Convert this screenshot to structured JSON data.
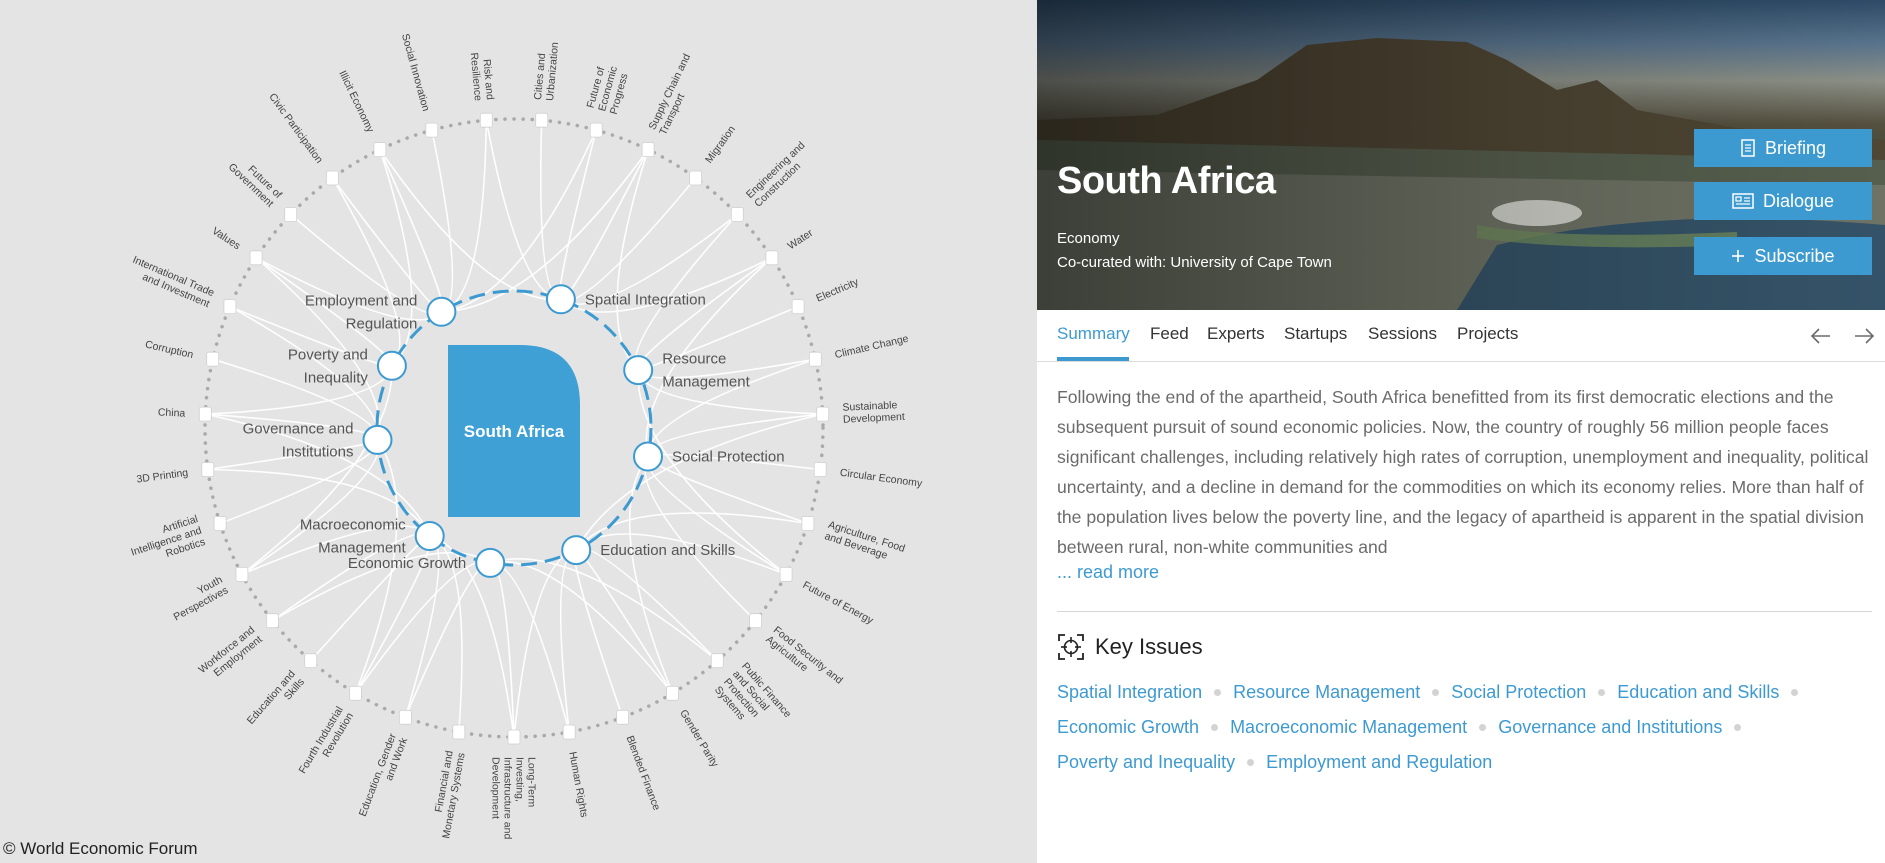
{
  "map": {
    "center_label": "South Africa",
    "copyright": "© World Economic Forum",
    "inner_nodes": [
      {
        "lines": [
          "Employment and",
          "Regulation"
        ]
      },
      {
        "lines": [
          "Spatial Integration"
        ]
      },
      {
        "lines": [
          "Resource",
          "Management"
        ]
      },
      {
        "lines": [
          "Social Protection"
        ]
      },
      {
        "lines": [
          "Education and Skills"
        ]
      },
      {
        "lines": [
          "Economic Growth"
        ]
      },
      {
        "lines": [
          "Macroeconomic",
          "Management"
        ]
      },
      {
        "lines": [
          "Governance and",
          "Institutions"
        ]
      },
      {
        "lines": [
          "Poverty and",
          "Inequality"
        ]
      }
    ],
    "outer_topics": [
      {
        "lines": [
          "Cities and",
          "Urbanization"
        ]
      },
      {
        "lines": [
          "Future of",
          "Economic",
          "Progress"
        ]
      },
      {
        "lines": [
          "Supply Chain and",
          "Transport"
        ]
      },
      {
        "lines": [
          "Migration"
        ]
      },
      {
        "lines": [
          "Engineering and",
          "Construction"
        ]
      },
      {
        "lines": [
          "Water"
        ]
      },
      {
        "lines": [
          "Electricity"
        ]
      },
      {
        "lines": [
          "Climate Change"
        ]
      },
      {
        "lines": [
          "Sustainable",
          "Development"
        ]
      },
      {
        "lines": [
          "Circular Economy"
        ]
      },
      {
        "lines": [
          "Agriculture, Food",
          "and Beverage"
        ]
      },
      {
        "lines": [
          "Future of Energy"
        ]
      },
      {
        "lines": [
          "Food Security and",
          "Agriculture"
        ]
      },
      {
        "lines": [
          "Public Finance",
          "and Social",
          "Protection",
          "Systems"
        ]
      },
      {
        "lines": [
          "Gender Parity"
        ]
      },
      {
        "lines": [
          "Blended Finance"
        ]
      },
      {
        "lines": [
          "Human Rights"
        ]
      },
      {
        "lines": [
          "Long-Term",
          "Investing,",
          "Infrastructure and",
          "Development"
        ]
      },
      {
        "lines": [
          "Financial and",
          "Monetary Systems"
        ]
      },
      {
        "lines": [
          "Education, Gender",
          "and Work"
        ]
      },
      {
        "lines": [
          "Fourth Industrial",
          "Revolution"
        ]
      },
      {
        "lines": [
          "Education and",
          "Skills"
        ]
      },
      {
        "lines": [
          "Workforce and",
          "Employment"
        ]
      },
      {
        "lines": [
          "Youth",
          "Perspectives"
        ]
      },
      {
        "lines": [
          "Artificial",
          "Intelligence and",
          "Robotics"
        ]
      },
      {
        "lines": [
          "3D Printing"
        ]
      },
      {
        "lines": [
          "China"
        ]
      },
      {
        "lines": [
          "Corruption"
        ]
      },
      {
        "lines": [
          "International Trade",
          "and Investment"
        ]
      },
      {
        "lines": [
          "Values"
        ]
      },
      {
        "lines": [
          "Future of",
          "Government"
        ]
      },
      {
        "lines": [
          "Civic Participation"
        ]
      },
      {
        "lines": [
          "Illicit Economy"
        ]
      },
      {
        "lines": [
          "Social Innovation"
        ]
      },
      {
        "lines": [
          "Risk and",
          "Resilience"
        ]
      }
    ]
  },
  "hero": {
    "title": "South Africa",
    "category": "Economy",
    "cocurated": "Co-curated with: University of Cape Town"
  },
  "buttons": {
    "briefing": "Briefing",
    "dialogue": "Dialogue",
    "subscribe": "Subscribe"
  },
  "tabs": [
    "Summary",
    "Feed",
    "Experts",
    "Startups",
    "Sessions",
    "Projects"
  ],
  "summary": {
    "text": "Following the end of the apartheid, South Africa benefitted from its first democratic elections and the subsequent pursuit of sound economic policies. Now, the country of roughly 56 million people faces significant challenges, including relatively high rates of corruption, unemployment and inequality, political uncertainty, and a decline in demand for the commodities on which its economy relies. More than half of the population lives below the poverty line, and the legacy of apartheid is apparent in the spatial division between rural, non-white communities and",
    "read_more": "... read more"
  },
  "key_issues": {
    "title": "Key Issues",
    "lines": [
      [
        "Spatial Integration",
        "Resource Management",
        "Social Protection",
        "Education and Skills"
      ],
      [
        "Economic Growth",
        "Macroeconomic Management",
        "Governance and Institutions"
      ],
      [
        "Poverty and Inequality",
        "Employment and Regulation"
      ]
    ]
  },
  "colors": {
    "accent": "#3d9ad1",
    "map_background": "#e4e4e4",
    "text_gray": "#6b6b6b"
  }
}
